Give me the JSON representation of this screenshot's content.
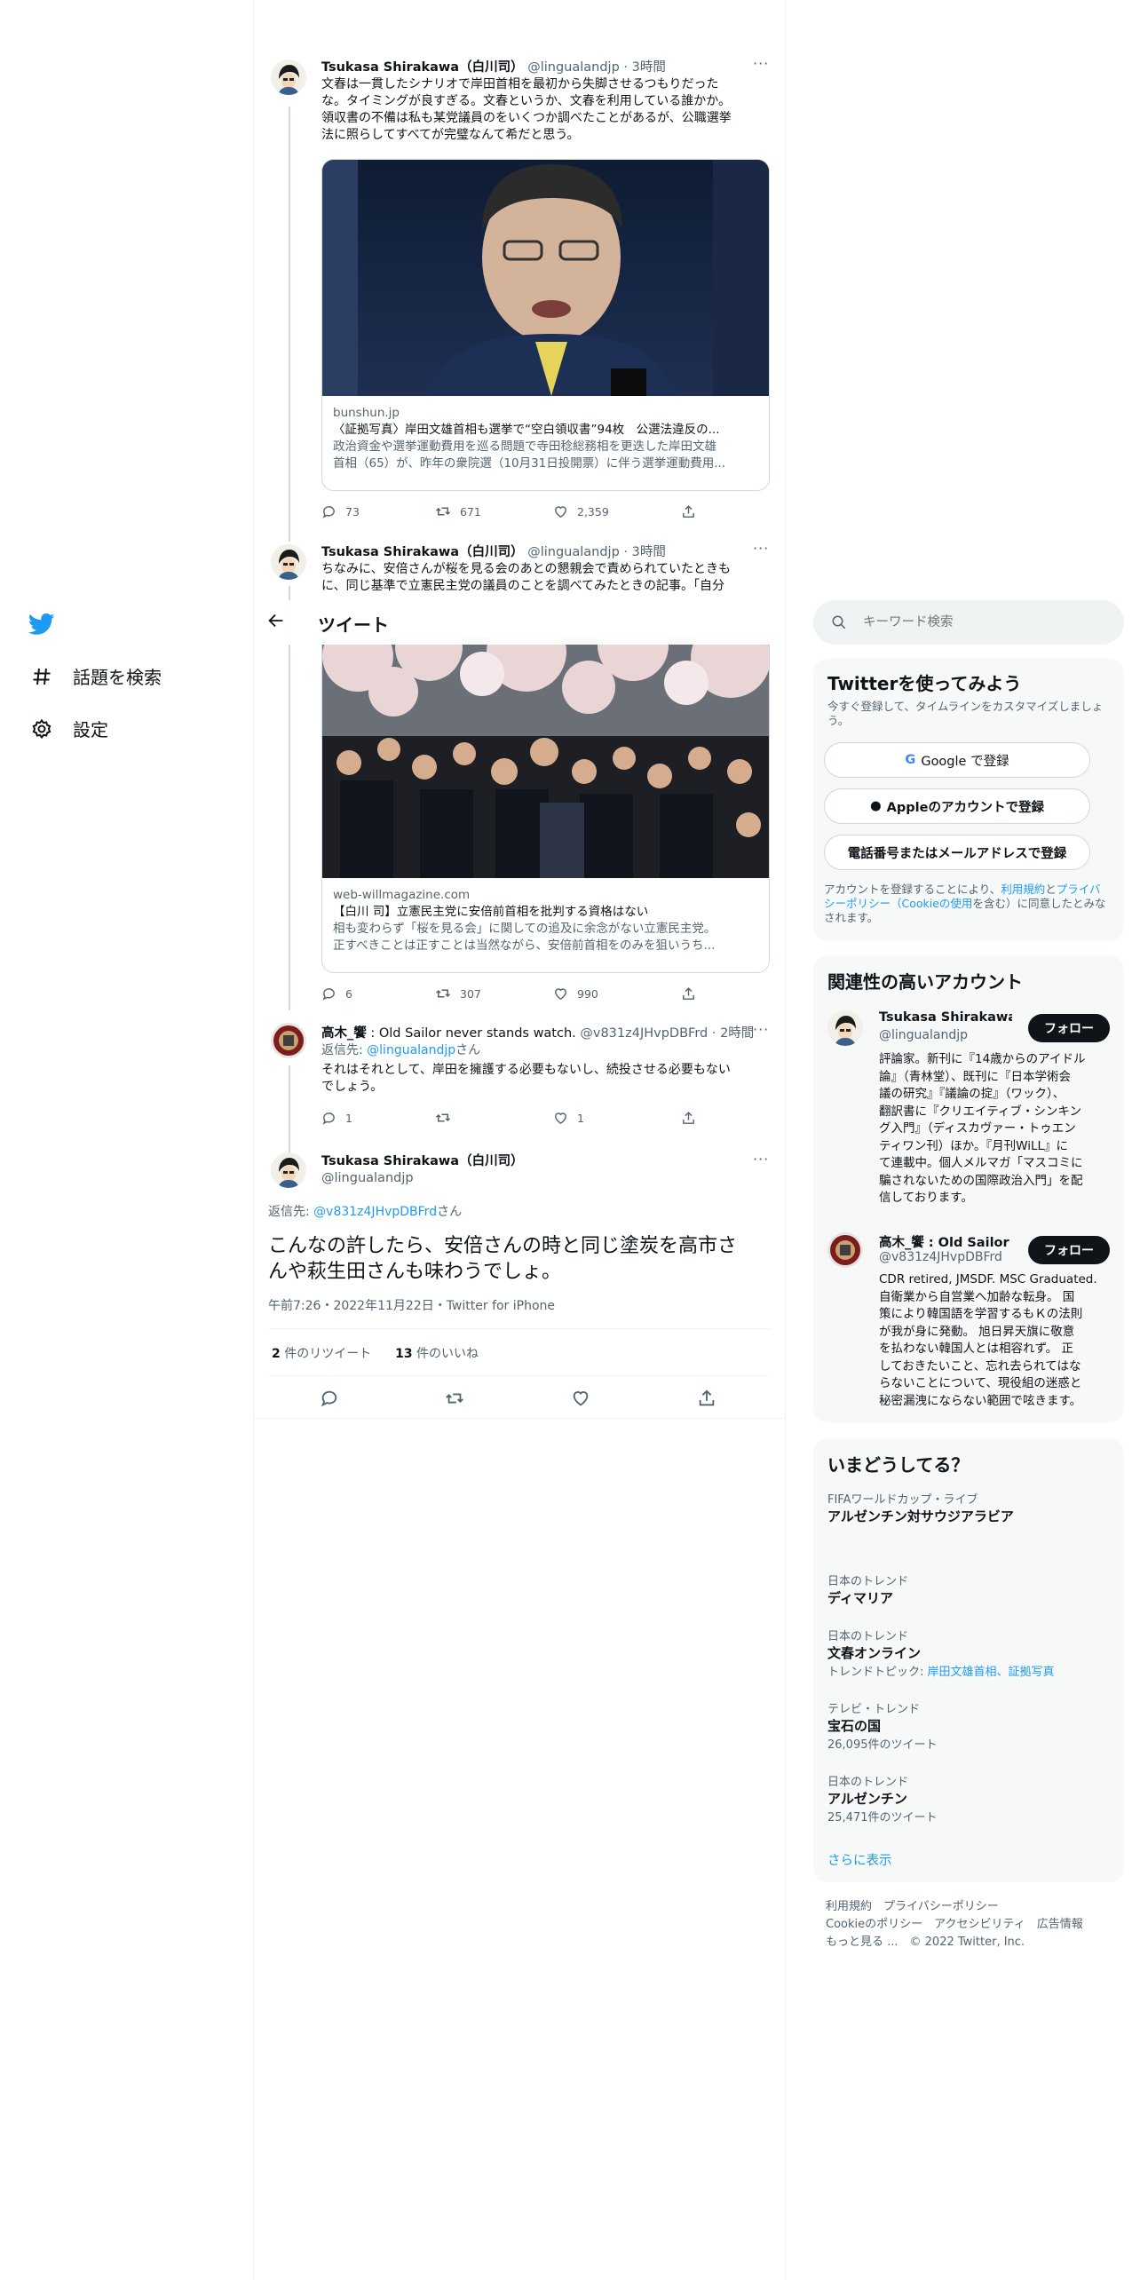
{
  "nav": {
    "items": [
      {
        "label": "話題を検索",
        "icon": "hashtag-icon"
      },
      {
        "label": "設定",
        "icon": "gear-icon"
      }
    ]
  },
  "header": {
    "title": "ツイート"
  },
  "search": {
    "placeholder": "キーワード検索"
  },
  "tweets": [
    {
      "name": "Tsukasa Shirakawa（白川司）",
      "handle": "@lingualandjp",
      "time": "3時間",
      "lines": [
        "文春は一貫したシナリオで岸田首相を最初から失脚させるつもりだった",
        "な。タイミングが良すぎる。文春というか、文春を利用している誰かか。",
        "領収書の不備は私も某党議員のをいくつか調べたことがあるが、公職選挙",
        "法に照らしてすべてが完璧なんて希だと思う。"
      ],
      "card": {
        "domain": "bunshun.jp",
        "title": "〈証拠写真〉岸田文雄首相も選挙で“空白領収書”94枚　公選法違反の...",
        "desc": [
          "政治資金や選挙運動費用を巡る問題で寺田稔総務相を更迭した岸田文雄",
          "首相（65）が、昨年の衆院選（10月31日投開票）に伴う選挙運動費用..."
        ]
      },
      "replies": "73",
      "retweets": "671",
      "likes": "2,359"
    },
    {
      "name": "Tsukasa Shirakawa（白川司）",
      "handle": "@lingualandjp",
      "time": "3時間",
      "lines": [
        "ちなみに、安倍さんが桜を見る会のあとの懇親会で責められていたときも",
        "に、同じ基準で立憲民主党の議員のことを調べてみたときの記事。「自分"
      ],
      "card": {
        "domain": "web-willmagazine.com",
        "title": "【白川 司】立憲民主党に安倍前首相を批判する資格はない",
        "desc": [
          "相も変わらず「桜を見る会」に関しての追及に余念がない立憲民主党。",
          "正すべきことは正すことは当然ながら、安倍前首相をのみを狙いうち..."
        ]
      },
      "replies": "6",
      "retweets": "307",
      "likes": "990"
    },
    {
      "name": "高木_饗",
      "name_suffix": " : Old Sailor never stands watch.",
      "handle": "@v831z4JHvpDBFrd",
      "time": "2時間",
      "reply_prefix": "返信先: ",
      "reply_to": "@lingualandjp",
      "reply_suffix": "さん",
      "lines": [
        "それはそれとして、岸田を擁護する必要もないし、続投させる必要もない",
        "でしょう。"
      ],
      "replies": "1",
      "retweets": "",
      "likes": "1"
    }
  ],
  "main_tweet": {
    "name": "Tsukasa Shirakawa（白川司）",
    "handle": "@lingualandjp",
    "reply_prefix": "返信先: ",
    "reply_to": "@v831z4JHvpDBFrd",
    "reply_suffix": "さん",
    "lines": [
      "こんなの許したら、安倍さんの時と同じ塗炭を高市さ",
      "んや萩生田さんも味わうでしょ。"
    ],
    "meta": "午前7:26・2022年11月22日・Twitter for iPhone",
    "retweet_count": "2",
    "retweet_label": " 件のリツイート",
    "like_count": "13",
    "like_label": " 件のいいね"
  },
  "signup": {
    "title": "Twitterを使ってみよう",
    "subtitle_lines": [
      "今すぐ登録して、タイムラインをカスタマイズしましょ",
      "う。"
    ],
    "google": "Google で登録",
    "apple": "Appleのアカウントで登録",
    "phone": "電話番号またはメールアドレスで登録",
    "legal_1": "アカウントを登録することにより、",
    "legal_terms": "利用規約",
    "legal_and": "と",
    "legal_privacy": "プライバシーポリシー（Cookieの使用",
    "legal_2": "を含む）に同意したとみなされます。"
  },
  "related": {
    "title": "関連性の高いアカウント",
    "accounts": [
      {
        "name": "Tsukasa Shirakawa...",
        "handle": "@lingualandjp",
        "follow": "フォロー",
        "bio_lines": [
          "評論家。新刊に『14歳からのアイドル",
          "論』（青林堂）、既刊に『日本学術会",
          "議の研究』『議論の掟』（ワック）、",
          "翻訳書に『クリエイティブ・シンキン",
          "グ入門』（ディスカヴァー・トゥエン",
          "ティワン刊）ほか。『月刊WiLL』に",
          "て連載中。個人メルマガ「マスコミに",
          "騙されないための国際政治入門」を配",
          "信しております。"
        ]
      },
      {
        "name": "高木_饗 : Old Sailor ...",
        "handle": "@v831z4JHvpDBFrd",
        "follow": "フォロー",
        "bio_lines": [
          "CDR retired, JMSDF. MSC Graduated.",
          "自衛業から自営業へ加齢な転身。 国",
          "策により韓国語を学習するもＫの法則",
          "が我が身に発動。 旭日昇天旗に敬意",
          "を払わない韓国人とは相容れず。 正",
          "しておきたいこと、忘れ去られてはな",
          "らないことについて、現役組の迷惑と",
          "秘密漏洩にならない範囲で呟きます。"
        ]
      }
    ]
  },
  "trends": {
    "title": "いまどうしてる？",
    "items": [
      {
        "category": "FIFAワールドカップ・ライブ",
        "name": "アルゼンチン対サウジアラビア",
        "sub": ""
      },
      {
        "category": "日本のトレンド",
        "name": "ディマリア",
        "sub": ""
      },
      {
        "category": "日本のトレンド",
        "name": "文春オンライン",
        "sub_prefix": "トレンドトピック: ",
        "sub_links": "岸田文雄首相、証拠写真"
      },
      {
        "category": "テレビ・トレンド",
        "name": "宝石の国",
        "sub": "26,095件のツイート"
      },
      {
        "category": "日本のトレンド",
        "name": "アルゼンチン",
        "sub": "25,471件のツイート"
      }
    ],
    "show_more": "さらに表示"
  },
  "footer": {
    "line1": "利用規約　プライバシーポリシー",
    "line2": "Cookieのポリシー　アクセシビリティ　広告情報",
    "line3": "もっと見る ...　© 2022 Twitter, Inc."
  },
  "colors": {
    "accent": "#1d9bf0",
    "text": "#0f1419",
    "muted": "#536471",
    "border": "#cfd9de"
  }
}
